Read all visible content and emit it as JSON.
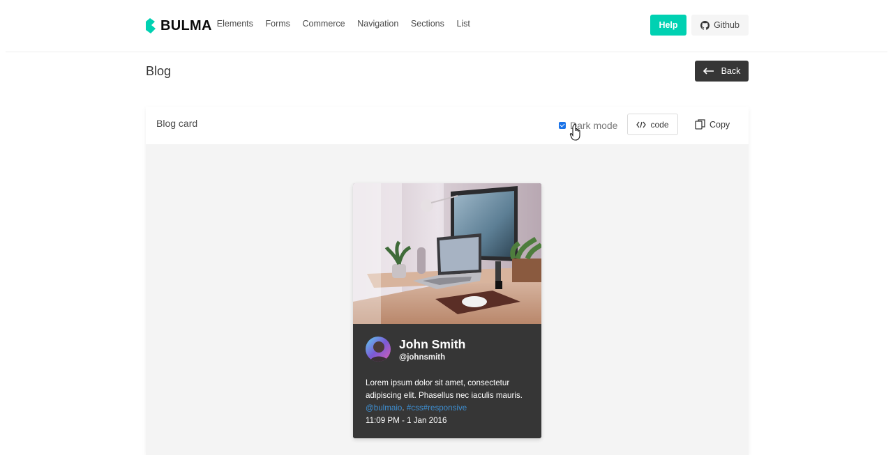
{
  "navbar": {
    "brand": "BULMA",
    "items": [
      "Elements",
      "Forms",
      "Commerce",
      "Navigation",
      "Sections",
      "List"
    ],
    "help_label": "Help",
    "github_label": "Github",
    "accent_color": "#00d1b2"
  },
  "page": {
    "title": "Blog",
    "back_label": "Back"
  },
  "showcase": {
    "title": "Blog card",
    "dark_mode_label": "Dark mode",
    "dark_mode_checked": true,
    "code_label": "code",
    "copy_label": "Copy"
  },
  "card": {
    "author_name": "John Smith",
    "author_handle": "@johnsmith",
    "text": "Lorem ipsum dolor sit amet, consectetur adipiscing elit. Phasellus nec iaculis mauris.",
    "mention": "@bulmaio",
    "separator": ".",
    "tags": "#css#responsive",
    "time": "11:09 PM - 1 Jan 2016"
  }
}
